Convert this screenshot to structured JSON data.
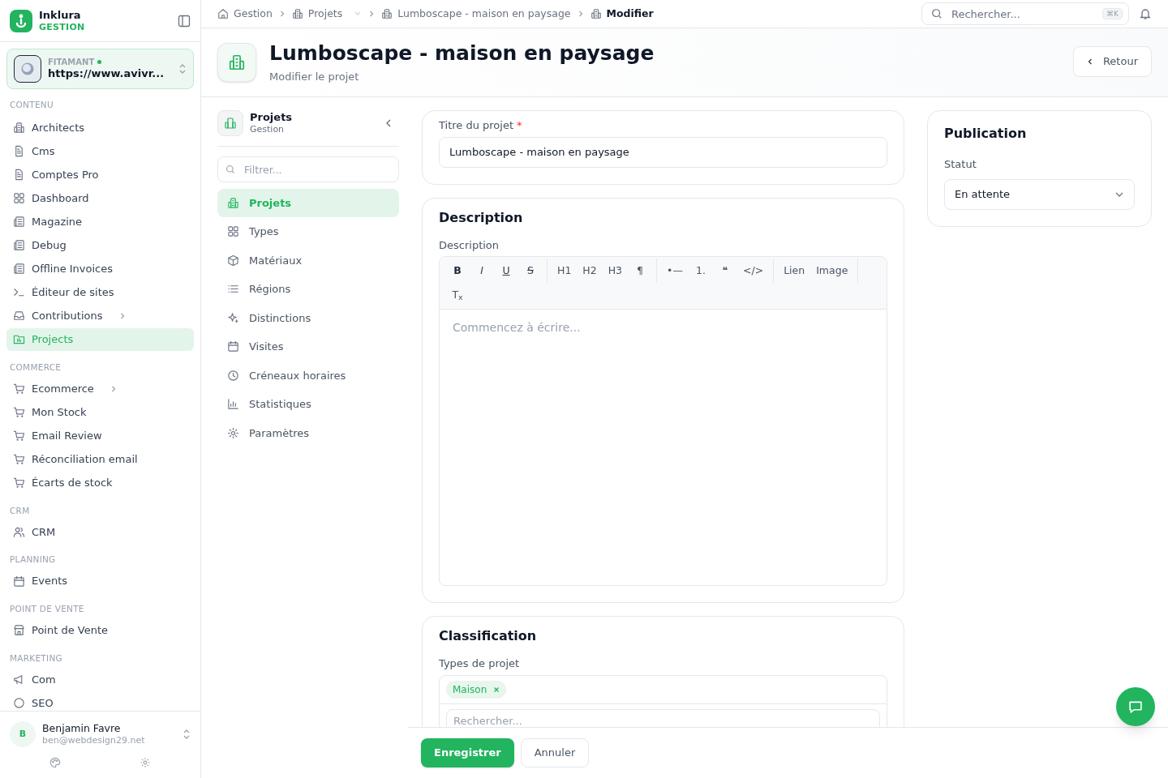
{
  "brand": {
    "name": "Inklura",
    "subtitle": "GESTION"
  },
  "site": {
    "label": "FITAMANT",
    "online": true,
    "url": "https://www.avivr..."
  },
  "sidebar": {
    "sections": [
      {
        "title": "CONTENU",
        "items": [
          {
            "label": "Architects",
            "selected": false,
            "submenu": false
          },
          {
            "label": "Cms",
            "selected": false,
            "submenu": false
          },
          {
            "label": "Comptes Pro",
            "selected": false,
            "submenu": false
          },
          {
            "label": "Dashboard",
            "selected": false,
            "submenu": false
          },
          {
            "label": "Magazine",
            "selected": false,
            "submenu": false
          },
          {
            "label": "Debug",
            "selected": false,
            "submenu": false
          },
          {
            "label": "Offline Invoices",
            "selected": false,
            "submenu": false
          },
          {
            "label": "Éditeur de sites",
            "selected": false,
            "submenu": false
          },
          {
            "label": "Contributions",
            "selected": false,
            "submenu": true
          },
          {
            "label": "Projects",
            "selected": true,
            "submenu": false
          }
        ]
      },
      {
        "title": "COMMERCE",
        "items": [
          {
            "label": "Ecommerce",
            "selected": false,
            "submenu": true
          },
          {
            "label": "Mon Stock",
            "selected": false,
            "submenu": false
          },
          {
            "label": "Email Review",
            "selected": false,
            "submenu": false
          },
          {
            "label": "Réconciliation email",
            "selected": false,
            "submenu": false
          },
          {
            "label": "Écarts de stock",
            "selected": false,
            "submenu": false
          }
        ]
      },
      {
        "title": "CRM",
        "items": [
          {
            "label": "CRM",
            "selected": false,
            "submenu": false
          }
        ]
      },
      {
        "title": "PLANNING",
        "items": [
          {
            "label": "Events",
            "selected": false,
            "submenu": false
          }
        ]
      },
      {
        "title": "POINT DE VENTE",
        "items": [
          {
            "label": "Point de Vente",
            "selected": false,
            "submenu": false
          }
        ]
      },
      {
        "title": "MARKETING",
        "items": [
          {
            "label": "Com",
            "selected": false,
            "submenu": false
          },
          {
            "label": "SEO",
            "selected": false,
            "submenu": false
          }
        ]
      }
    ]
  },
  "user": {
    "initial": "B",
    "name": "Benjamin Favre",
    "email": "ben@webdesign29.net"
  },
  "breadcrumbs": [
    {
      "label": "Gestion",
      "current": false,
      "dropdown": false
    },
    {
      "label": "Projets",
      "current": false,
      "dropdown": true
    },
    {
      "label": "Lumboscape - maison en paysage",
      "current": false,
      "dropdown": false
    },
    {
      "label": "Modifier",
      "current": true,
      "dropdown": false
    }
  ],
  "search": {
    "placeholder": "Rechercher...",
    "shortcut": "⌘K"
  },
  "header": {
    "title": "Lumboscape - maison en paysage",
    "subtitle": "Modifier le projet",
    "back": "Retour"
  },
  "subnav": {
    "title": "Projets",
    "subtitle": "Gestion",
    "filter_placeholder": "Filtrer...",
    "items": [
      {
        "label": "Projets",
        "selected": true
      },
      {
        "label": "Types",
        "selected": false
      },
      {
        "label": "Matériaux",
        "selected": false
      },
      {
        "label": "Régions",
        "selected": false
      },
      {
        "label": "Distinctions",
        "selected": false
      },
      {
        "label": "Visites",
        "selected": false
      },
      {
        "label": "Créneaux horaires",
        "selected": false
      },
      {
        "label": "Statistiques",
        "selected": false
      },
      {
        "label": "Paramètres",
        "selected": false
      }
    ]
  },
  "title_field": {
    "label": "Titre du projet",
    "required_mark": "*",
    "value": "Lumboscape - maison en paysage"
  },
  "description": {
    "heading": "Description",
    "label": "Description",
    "toolbar": [
      [
        {
          "text": "B",
          "kind": "bold"
        },
        {
          "text": "I",
          "kind": "italic"
        },
        {
          "text": "U",
          "kind": "underline"
        },
        {
          "text": "S",
          "kind": "strike"
        }
      ],
      [
        {
          "text": "H1",
          "kind": "plain"
        },
        {
          "text": "H2",
          "kind": "plain"
        },
        {
          "text": "H3",
          "kind": "plain"
        },
        {
          "text": "¶",
          "kind": "plain"
        }
      ],
      [
        {
          "text": "•—",
          "kind": "plain"
        },
        {
          "text": "1.",
          "kind": "plain"
        },
        {
          "text": "❝",
          "kind": "plain"
        },
        {
          "text": "</>",
          "kind": "plain"
        }
      ],
      [
        {
          "text": "Lien",
          "kind": "plain"
        },
        {
          "text": "Image",
          "kind": "plain"
        }
      ],
      [
        {
          "text": "T$_{x}$",
          "kind": "plain"
        }
      ]
    ],
    "placeholder": "Commencez à écrire..."
  },
  "classification": {
    "heading": "Classification",
    "label": "Types de projet",
    "tags": [
      "Maison"
    ],
    "search_placeholder": "Rechercher..."
  },
  "publication": {
    "heading": "Publication",
    "label": "Statut",
    "value": "En attente"
  },
  "actions": {
    "save": "Enregistrer",
    "cancel": "Annuler"
  }
}
